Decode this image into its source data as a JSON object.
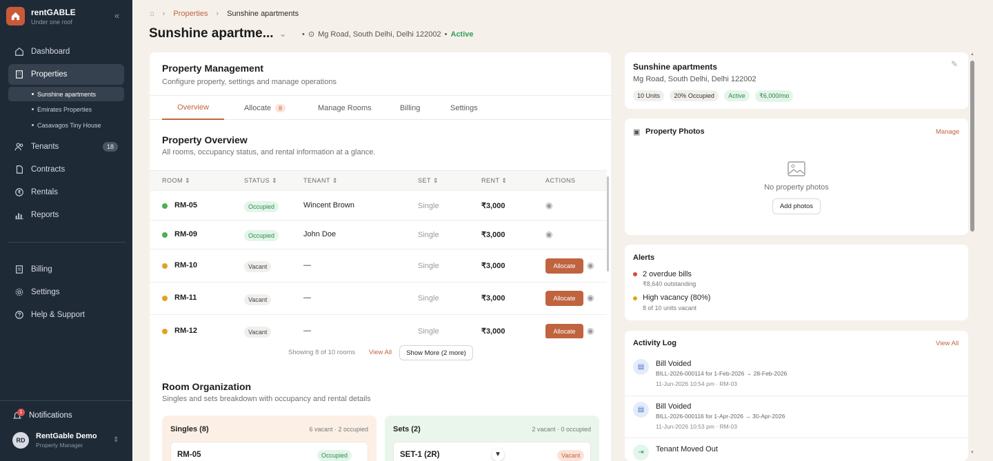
{
  "brand": {
    "name": "rentGABLE",
    "tagline": "Under one roof"
  },
  "sidebar": {
    "items": [
      {
        "label": "Dashboard",
        "icon": "home-icon"
      },
      {
        "label": "Properties",
        "icon": "building-icon"
      },
      {
        "label": "Tenants",
        "icon": "users-icon",
        "badge": "18"
      },
      {
        "label": "Contracts",
        "icon": "document-icon"
      },
      {
        "label": "Rentals",
        "icon": "rupee-icon"
      },
      {
        "label": "Reports",
        "icon": "chart-icon"
      },
      {
        "label": "Billing",
        "icon": "bill-icon"
      },
      {
        "label": "Settings",
        "icon": "gear-icon"
      },
      {
        "label": "Help & Support",
        "icon": "help-icon"
      }
    ],
    "subitems": [
      "Sunshine apartments",
      "Emirates Properties",
      "Casavagos Tiny House"
    ],
    "notifications": {
      "label": "Notifications",
      "count": "1"
    },
    "user": {
      "initials": "RD",
      "name": "RentGable Demo",
      "role": "Property Manager"
    }
  },
  "breadcrumb": {
    "parent": "Properties",
    "current": "Sunshine apartments"
  },
  "page": {
    "title": "Sunshine apartme...",
    "address": "Mg Road, South Delhi, Delhi 122002",
    "status": "Active"
  },
  "management": {
    "title": "Property Management",
    "subtitle": "Configure property, settings and manage operations",
    "tabs": [
      {
        "label": "Overview"
      },
      {
        "label": "Allocate",
        "count": "8"
      },
      {
        "label": "Manage Rooms"
      },
      {
        "label": "Billing"
      },
      {
        "label": "Settings"
      }
    ]
  },
  "overview": {
    "title": "Property Overview",
    "subtitle": "All rooms, occupancy status, and rental information at a glance.",
    "columns": [
      "ROOM",
      "STATUS",
      "TENANT",
      "SET",
      "RENT",
      "ACTIONS"
    ],
    "rows": [
      {
        "room": "RM-05",
        "status": "Occupied",
        "tenant": "Wincent Brown",
        "set": "Single",
        "rent": "₹3,000"
      },
      {
        "room": "RM-09",
        "status": "Occupied",
        "tenant": "John Doe",
        "set": "Single",
        "rent": "₹3,000"
      },
      {
        "room": "RM-10",
        "status": "Vacant",
        "tenant": "—",
        "set": "Single",
        "rent": "₹3,000",
        "action": "Allocate"
      },
      {
        "room": "RM-11",
        "status": "Vacant",
        "tenant": "—",
        "set": "Single",
        "rent": "₹3,000",
        "action": "Allocate"
      },
      {
        "room": "RM-12",
        "status": "Vacant",
        "tenant": "—",
        "set": "Single",
        "rent": "₹3,000",
        "action": "Allocate"
      }
    ],
    "showing": "Showing 8 of 10 rooms",
    "view_all": "View All",
    "show_more": "Show More (2 more)"
  },
  "organization": {
    "title": "Room Organization",
    "subtitle": "Singles and sets breakdown with occupancy and rental details",
    "singles": {
      "title": "Singles (8)",
      "meta": "6 vacant · 2 occupied",
      "item": "RM-05",
      "status": "Occupied"
    },
    "sets": {
      "title": "Sets (2)",
      "meta": "2 vacant · 0 occupied",
      "item": "SET-1 (2R)",
      "status": "Vacant"
    }
  },
  "summary": {
    "name": "Sunshine apartments",
    "address": "Mg Road, South Delhi, Delhi 122002",
    "chips": [
      "10 Units",
      "20% Occupied",
      "Active",
      "₹6,000/mo"
    ]
  },
  "photos": {
    "title": "Property Photos",
    "manage": "Manage",
    "empty": "No property photos",
    "add": "Add photos"
  },
  "alerts": {
    "title": "Alerts",
    "items": [
      {
        "title": "2 overdue bills",
        "detail": "₹8,640 outstanding",
        "color": "#d9463f"
      },
      {
        "title": "High vacancy (80%)",
        "detail": "8 of 10 units vacant",
        "color": "#e3a21a"
      }
    ]
  },
  "activity": {
    "title": "Activity Log",
    "view_all": "View All",
    "items": [
      {
        "title": "Bill Voided",
        "detail": "BILL-2026-000114 for 1-Feb-2026 → 28-Feb-2026",
        "meta": "11-Jun-2026 10:54 pm · RM-03"
      },
      {
        "title": "Bill Voided",
        "detail": "BILL-2026-000116 for 1-Apr-2026 → 30-Apr-2026",
        "meta": "11-Jun-2026 10:53 pm · RM-03"
      },
      {
        "title": "Tenant Moved Out",
        "detail": "",
        "meta": ""
      }
    ]
  },
  "colors": {
    "accent": "#c0633f",
    "sidebar": "#1f2a37",
    "active_green": "#2f9e5b"
  }
}
